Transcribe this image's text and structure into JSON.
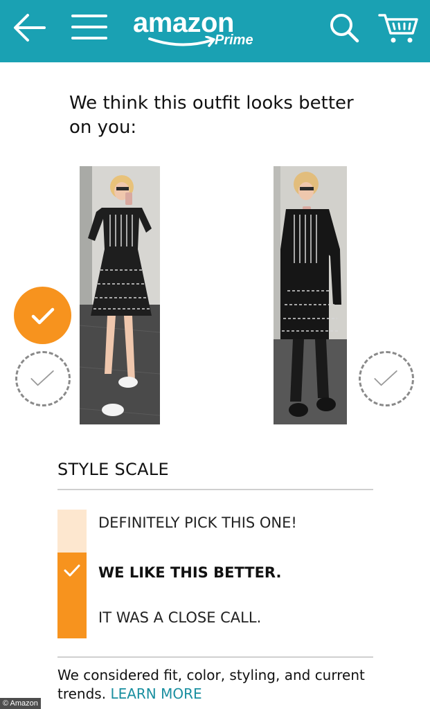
{
  "header": {
    "logo_text": "amazon",
    "logo_subtext": "Prime",
    "icons": [
      "back-arrow-icon",
      "hamburger-menu-icon",
      "search-icon",
      "cart-icon"
    ],
    "background_color": "#1aa1b3"
  },
  "main": {
    "headline": "We think this outfit looks better on you:",
    "outfits": [
      {
        "selected": true
      },
      {
        "selected": false
      }
    ],
    "accent_color": "#f7931e"
  },
  "style_scale": {
    "title": "STYLE SCALE",
    "items": [
      {
        "label": "DEFINITELY PICK THIS ONE!"
      },
      {
        "label": "WE LIKE THIS BETTER."
      },
      {
        "label": "IT WAS A CLOSE CALL."
      }
    ],
    "selected_level": "WE LIKE THIS BETTER."
  },
  "footnote": {
    "text": "We considered fit, color, styling, and current trends.",
    "link": "LEARN MORE"
  },
  "credit": "© Amazon"
}
